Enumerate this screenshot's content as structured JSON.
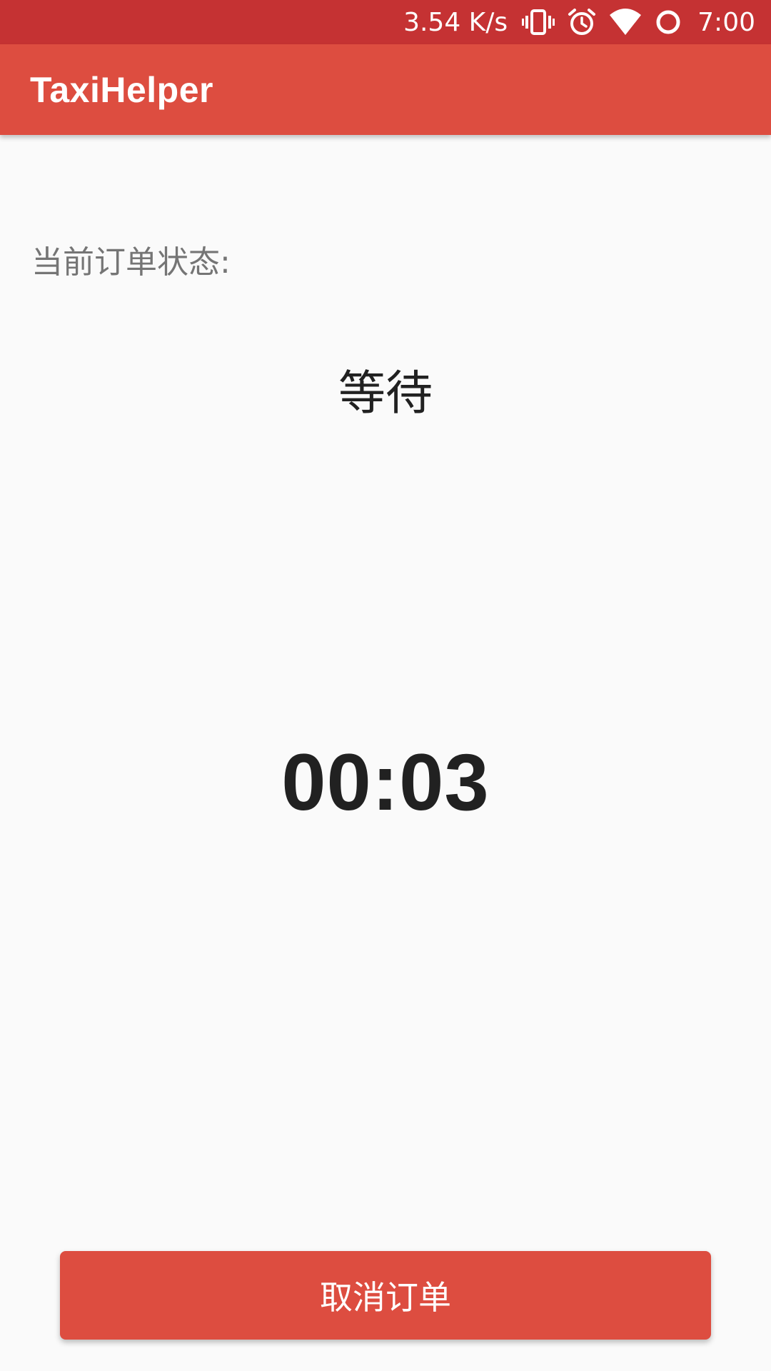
{
  "status_bar": {
    "network_speed": "3.54 K/s",
    "time": "7:00",
    "icons": [
      "vibrate-icon",
      "alarm-icon",
      "wifi-icon",
      "circle-icon"
    ]
  },
  "app_bar": {
    "title": "TaxiHelper"
  },
  "order": {
    "status_label": "当前订单状态:",
    "status_value": "等待",
    "timer": "00:03"
  },
  "actions": {
    "cancel_label": "取消订单"
  },
  "colors": {
    "status_bar": "#c53233",
    "primary": "#dd4d40",
    "background": "#fafafa"
  }
}
